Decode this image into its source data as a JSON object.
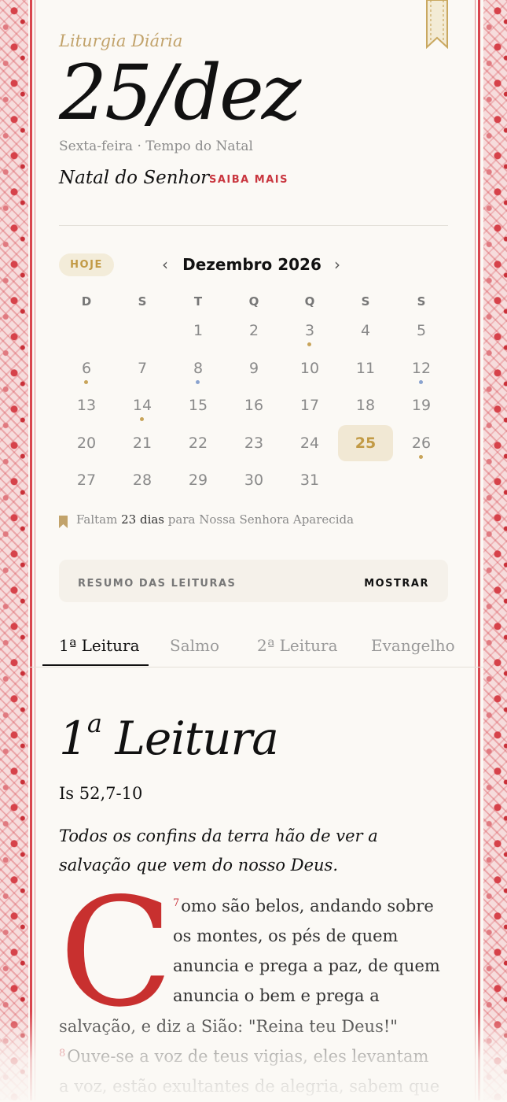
{
  "header": {
    "app_title": "Liturgia Diária",
    "date": "25/dez",
    "subtitle_day": "Sexta-feira",
    "subtitle_season": "Tempo do Natal",
    "feast": "Natal do Senhor",
    "saiba_mais": "SAIBA MAIS"
  },
  "calendar": {
    "today_button": "HOJE",
    "prev": "‹",
    "next": "›",
    "month_label": "Dezembro 2026",
    "weekdays": [
      "D",
      "S",
      "T",
      "Q",
      "Q",
      "S",
      "S"
    ],
    "weeks": [
      [
        "",
        "",
        "1",
        "2",
        "3",
        "4",
        "5"
      ],
      [
        "6",
        "7",
        "8",
        "9",
        "10",
        "11",
        "12"
      ],
      [
        "13",
        "14",
        "15",
        "16",
        "17",
        "18",
        "19"
      ],
      [
        "20",
        "21",
        "22",
        "23",
        "24",
        "25",
        "26"
      ],
      [
        "27",
        "28",
        "29",
        "30",
        "31",
        "",
        ""
      ]
    ],
    "selected_day": "25",
    "dots": {
      "3": "#c8a45a",
      "6": "#c8a45a",
      "8": "#8aa3cf",
      "12": "#8aa3cf",
      "14": "#c8a45a",
      "26": "#c8a45a"
    }
  },
  "countdown": {
    "prefix": "Faltam",
    "days": "23 dias",
    "suffix": "para Nossa Senhora Aparecida"
  },
  "summary": {
    "label": "RESUMO DAS LEITURAS",
    "action": "MOSTRAR"
  },
  "tabs": [
    "1ª Leitura",
    "Salmo",
    "2ª Leitura",
    "Evangelho"
  ],
  "reading": {
    "title_number": "1",
    "title_sup": "a",
    "title_word": "Leitura",
    "reference": "Is 52,7-10",
    "lead_line1": "Todos os confins da terra hão de ver a",
    "lead_line2": "salvação que vem do nosso Deus.",
    "dropcap": "C",
    "verse7": "7",
    "line1": "omo são belos, andando sobre",
    "line2": "os montes, os pés de quem",
    "line3": "anuncia e prega a paz, de quem",
    "line4": "anuncia o bem e prega a",
    "line5": "salvação, e diz a Sião: \"Reina teu Deus!\"",
    "verse8": "8",
    "line6": "Ouve-se a voz de teus vigias, eles levantam",
    "line7": "a voz, estão exultantes de alegria, sabem que"
  },
  "colors": {
    "accent_red": "#c9363f",
    "accent_gold": "#c2a36b",
    "today_bg": "#f1e8d4"
  }
}
